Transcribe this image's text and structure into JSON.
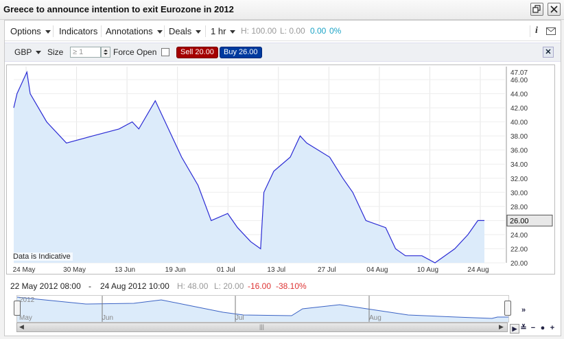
{
  "window": {
    "title": "Greece to announce intention to exit Eurozone in 2012"
  },
  "toolbar": {
    "options": "Options",
    "indicators": "Indicators",
    "annotations": "Annotations",
    "deals": "Deals",
    "interval": "1 hr",
    "high": "H: 100.00",
    "low": "L: 0.00",
    "change": "0.00",
    "change_pct": "0%"
  },
  "trade_bar": {
    "currency": "GBP",
    "size_label": "Size",
    "size_placeholder": "≥ 1",
    "force_open": "Force Open",
    "sell": "Sell 20.00",
    "buy": "Buy 26.00"
  },
  "chart": {
    "watermark": "Data is Indicative",
    "current_value_label": "26.00",
    "line_color": "#2a2ad4",
    "fill_color": "#dcebfa"
  },
  "range": {
    "start": "22 May 2012 08:00",
    "dash": "-",
    "end": "24 Aug 2012 10:00",
    "high": "H: 48.00",
    "low": "L: 20.00",
    "change": "-16.00",
    "change_pct": "-38.10%"
  },
  "navigator": {
    "year": "2012",
    "months": [
      "May",
      "Jun",
      "Jul",
      "Aug"
    ]
  },
  "chart_data": {
    "type": "area",
    "y_ticks": [
      "47.07",
      "46.00",
      "44.00",
      "42.00",
      "40.00",
      "38.00",
      "36.00",
      "34.00",
      "32.00",
      "30.00",
      "28.00",
      "26.00",
      "24.00",
      "22.00",
      "20.00"
    ],
    "x_ticks": [
      "24 May",
      "30 May",
      "13 Jun",
      "19 Jun",
      "01 Jul",
      "13 Jul",
      "27 Jul",
      "04 Aug",
      "10 Aug",
      "24 Aug"
    ],
    "ylim": [
      20,
      47.07
    ],
    "x_index_range": [
      0,
      100
    ],
    "x": [
      0,
      1,
      4,
      5,
      10,
      16,
      24,
      32,
      36,
      38,
      43,
      48,
      51,
      56,
      60,
      65,
      68,
      72,
      75,
      76,
      79,
      84,
      87,
      89,
      96,
      100,
      103,
      107,
      113,
      116,
      119,
      124,
      128,
      131,
      134,
      138,
      141,
      143
    ],
    "values": [
      42,
      44,
      47.07,
      44,
      40,
      37,
      38,
      39,
      40,
      39,
      43,
      38,
      35,
      31,
      26,
      27,
      25,
      23,
      22,
      30,
      33,
      35,
      38,
      37,
      35,
      32,
      30,
      26,
      25,
      22,
      21,
      21,
      20,
      21,
      22,
      24,
      26,
      26
    ],
    "x_max": 143
  }
}
